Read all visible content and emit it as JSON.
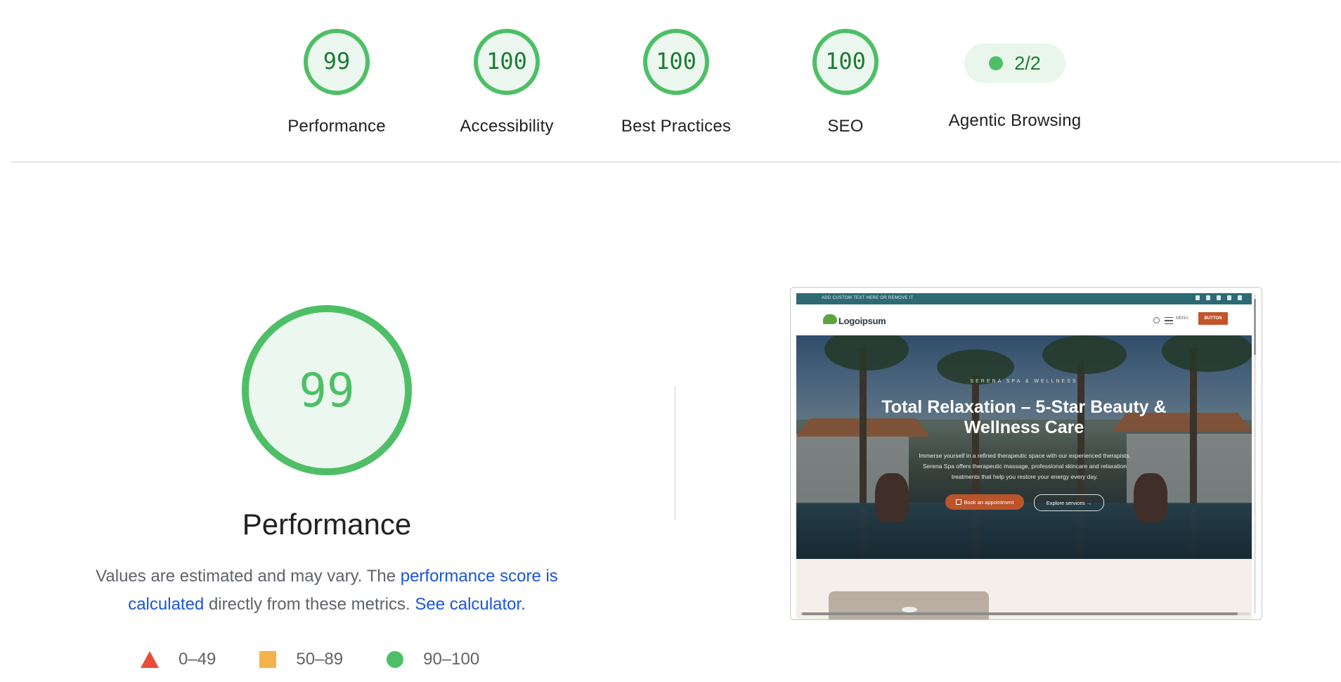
{
  "scores": [
    {
      "value": "99",
      "label": "Performance"
    },
    {
      "value": "100",
      "label": "Accessibility"
    },
    {
      "value": "100",
      "label": "Best Practices"
    },
    {
      "value": "100",
      "label": "SEO"
    }
  ],
  "agentic": {
    "value": "2/2",
    "label": "Agentic Browsing"
  },
  "performance": {
    "score": "99",
    "title": "Performance",
    "desc_prefix": "Values are estimated and may vary. The ",
    "link_score": "performance score is calculated",
    "desc_middle": " directly from these metrics. ",
    "link_calculator": "See calculator.",
    "legend": [
      {
        "range": "0–49",
        "shape": "triangle",
        "color": "#eb4c3a"
      },
      {
        "range": "50–89",
        "shape": "square",
        "color": "#f5b24b"
      },
      {
        "range": "90–100",
        "shape": "circle",
        "color": "#4fbf67"
      }
    ]
  },
  "colors": {
    "pass": "#4fbf67",
    "pass_fill": "#ecf8ef",
    "pass_text": "#1e7a34",
    "link": "#1a56db"
  },
  "screenshot": {
    "topbar_text": "ADD CUSTOM TEXT HERE OR REMOVE IT",
    "logo": "Logoipsum",
    "menu": "MENU",
    "button": "BUTTON",
    "eyebrow": "SERENA SPA & WELLNESS",
    "title": "Total Relaxation – 5-Star Beauty & Wellness Care",
    "subtitle": "Immerse yourself in a refined therapeutic space with our experienced therapists. Serena Spa offers therapeutic massage, professional skincare and relaxation treatments that help you restore your energy every day.",
    "cta_primary": "Book an appointment",
    "cta_secondary": "Explore services →"
  }
}
